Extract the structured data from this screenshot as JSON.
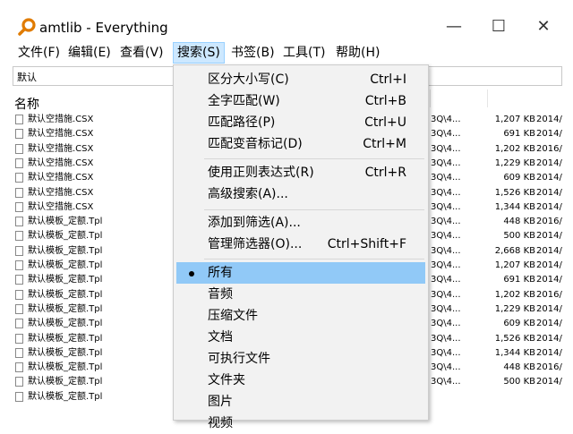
{
  "window": {
    "title": "amtlib - Everything",
    "minimize": "—",
    "maximize": "☐",
    "close": "✕",
    "accent": "#91c9f7"
  },
  "menubar": {
    "items": [
      {
        "label": "文件(F)"
      },
      {
        "label": "编辑(E)"
      },
      {
        "label": "查看(V)"
      },
      {
        "label": "搜索(S)"
      },
      {
        "label": "书签(B)"
      },
      {
        "label": "工具(T)"
      },
      {
        "label": "帮助(H)"
      }
    ]
  },
  "search": {
    "value": "默认"
  },
  "columns": {
    "name": "名称"
  },
  "files": [
    {
      "name": "默认空措施.CSX",
      "path": "3Q\\4...",
      "size": "1,207 KB",
      "date": "2014/"
    },
    {
      "name": "默认空措施.CSX",
      "path": "3Q\\4...",
      "size": "691 KB",
      "date": "2014/"
    },
    {
      "name": "默认空措施.CSX",
      "path": "3Q\\4...",
      "size": "1,202 KB",
      "date": "2016/"
    },
    {
      "name": "默认空措施.CSX",
      "path": "3Q\\4...",
      "size": "1,229 KB",
      "date": "2014/"
    },
    {
      "name": "默认空措施.CSX",
      "path": "3Q\\4...",
      "size": "609 KB",
      "date": "2014/"
    },
    {
      "name": "默认空措施.CSX",
      "path": "3Q\\4...",
      "size": "1,526 KB",
      "date": "2014/"
    },
    {
      "name": "默认空措施.CSX",
      "path": "3Q\\4...",
      "size": "1,344 KB",
      "date": "2014/"
    },
    {
      "name": "默认模板_定额.Tpl",
      "path": "3Q\\4...",
      "size": "448 KB",
      "date": "2016/"
    },
    {
      "name": "默认模板_定额.Tpl",
      "path": "3Q\\4...",
      "size": "500 KB",
      "date": "2014/"
    },
    {
      "name": "默认模板_定额.Tpl",
      "path": "3Q\\4...",
      "size": "2,668 KB",
      "date": "2014/"
    },
    {
      "name": "默认模板_定额.Tpl",
      "path": "3Q\\4...",
      "size": "1,207 KB",
      "date": "2014/"
    },
    {
      "name": "默认模板_定额.Tpl",
      "path": "3Q\\4...",
      "size": "691 KB",
      "date": "2014/"
    },
    {
      "name": "默认模板_定额.Tpl",
      "path": "3Q\\4...",
      "size": "1,202 KB",
      "date": "2016/"
    },
    {
      "name": "默认模板_定额.Tpl",
      "path": "3Q\\4...",
      "size": "1,229 KB",
      "date": "2014/"
    },
    {
      "name": "默认模板_定额.Tpl",
      "path": "3Q\\4...",
      "size": "609 KB",
      "date": "2014/"
    },
    {
      "name": "默认模板_定额.Tpl",
      "path": "3Q\\4...",
      "size": "1,526 KB",
      "date": "2014/"
    },
    {
      "name": "默认模板_定额.Tpl",
      "path": "3Q\\4...",
      "size": "1,344 KB",
      "date": "2014/"
    },
    {
      "name": "默认模板_定额.Tpl",
      "path": "3Q\\4...",
      "size": "448 KB",
      "date": "2016/"
    },
    {
      "name": "默认模板_定额.Tpl",
      "path": "3Q\\4...",
      "size": "500 KB",
      "date": "2014/"
    },
    {
      "name": "默认模板_定额.Tpl",
      "path": "",
      "size": "",
      "date": ""
    }
  ],
  "search_menu": {
    "items": [
      {
        "label": "区分大小写(C)",
        "shortcut": "Ctrl+I"
      },
      {
        "label": "全字匹配(W)",
        "shortcut": "Ctrl+B"
      },
      {
        "label": "匹配路径(P)",
        "shortcut": "Ctrl+U"
      },
      {
        "label": "匹配变音标记(D)",
        "shortcut": "Ctrl+M"
      },
      {
        "label": "使用正则表达式(R)",
        "shortcut": "Ctrl+R"
      },
      {
        "label": "高级搜索(A)...",
        "shortcut": ""
      },
      {
        "label": "添加到筛选(A)...",
        "shortcut": ""
      },
      {
        "label": "管理筛选器(O)...",
        "shortcut": "Ctrl+Shift+F"
      },
      {
        "label": "所有",
        "shortcut": ""
      },
      {
        "label": "音频",
        "shortcut": ""
      },
      {
        "label": "压缩文件",
        "shortcut": ""
      },
      {
        "label": "文档",
        "shortcut": ""
      },
      {
        "label": "可执行文件",
        "shortcut": ""
      },
      {
        "label": "文件夹",
        "shortcut": ""
      },
      {
        "label": "图片",
        "shortcut": ""
      },
      {
        "label": "视频",
        "shortcut": ""
      }
    ]
  }
}
